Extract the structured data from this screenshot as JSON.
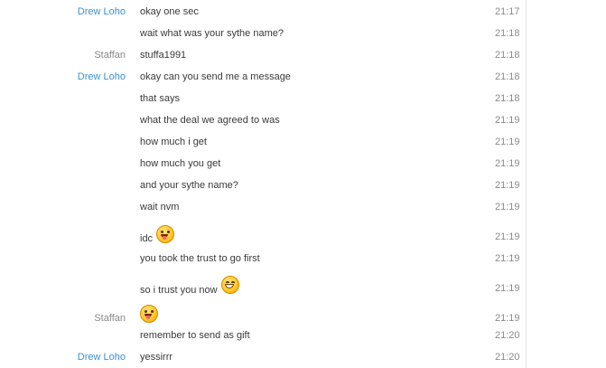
{
  "messages": [
    {
      "sender": "Drew Loho",
      "text": "okay one sec",
      "time": "21:17"
    },
    {
      "sender": "",
      "text": "wait what was your sythe name?",
      "time": "21:18"
    },
    {
      "sender": "Staffan",
      "text": "stuffa1991",
      "time": "21:18"
    },
    {
      "sender": "Drew Loho",
      "text": "okay can you send me a message",
      "time": "21:18"
    },
    {
      "sender": "",
      "text": "that says",
      "time": "21:18"
    },
    {
      "sender": "",
      "text": "what the deal we agreed to was",
      "time": "21:19"
    },
    {
      "sender": "",
      "text": "how much i get",
      "time": "21:19"
    },
    {
      "sender": "",
      "text": "how much you get",
      "time": "21:19"
    },
    {
      "sender": "",
      "text": "and your sythe name?",
      "time": "21:19"
    },
    {
      "sender": "",
      "text": "wait nvm",
      "time": "21:19"
    },
    {
      "sender": "",
      "text": "idc",
      "emoji": "tongue-out-emoji",
      "time": "21:19"
    },
    {
      "sender": "",
      "text": "you took the trust to go first",
      "time": "21:19"
    },
    {
      "sender": "",
      "text": "so i trust you now",
      "emoji": "big-grin-emoji",
      "time": "21:19"
    },
    {
      "sender": "Staffan",
      "text": "",
      "emoji": "tongue-out-emoji",
      "time": "21:19"
    },
    {
      "sender": "",
      "text": "remember to send as gift",
      "time": "21:20"
    },
    {
      "sender": "Drew Loho",
      "text": "yessirrr",
      "time": "21:20"
    }
  ],
  "colors": {
    "drew": "#3d8fd0",
    "staffan": "#8a8a8a",
    "time": "#8a8a8a"
  }
}
